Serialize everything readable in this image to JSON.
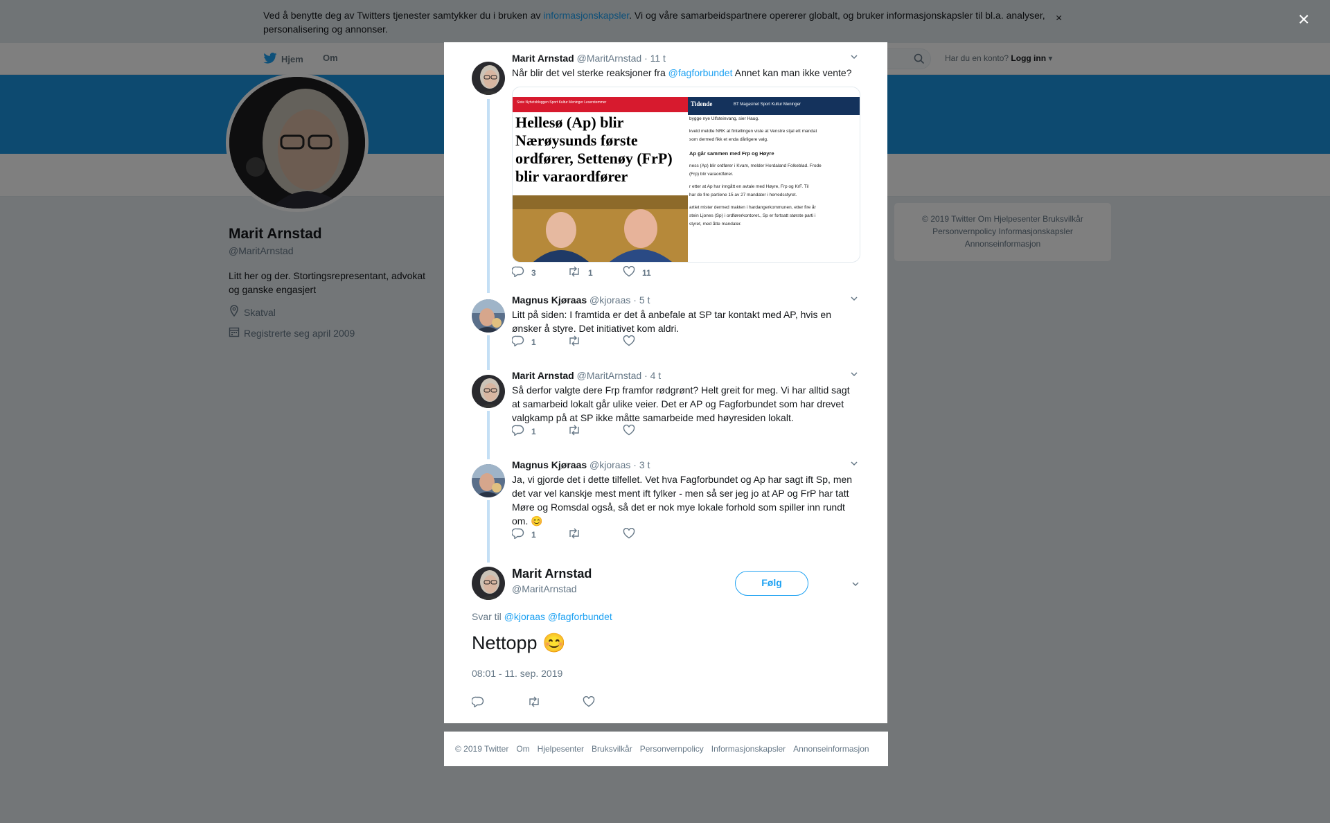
{
  "cookie_bar": {
    "text_before": "Ved å benytte deg av Twitters tjenester samtykker du i bruken av ",
    "link": "informasjonskapsler",
    "text_after": ". Vi og våre samarbeidspartnere opererer globalt, og bruker informasjonskapsler til bl.a. analyser, personalisering og annonser.",
    "close": "×"
  },
  "nav": {
    "home": "Hjem",
    "about": "Om",
    "account_q": "Har du en konto?",
    "login": "Logg inn"
  },
  "profile": {
    "name": "Marit Arnstad",
    "handle": "@MaritArnstad",
    "bio": "Litt her og der. Stortingsrepresentant, advokat og ganske engasjert",
    "location": "Skatval",
    "joined": "Registrerte seg april 2009"
  },
  "right_footer": {
    "line1": "© 2019 Twitter   Om   Hjelpesenter   Bruksvilkår",
    "line2": "Personvernpolicy   Informasjonskapsler",
    "line3": "Annonseinformasjon"
  },
  "overlay_close": "×",
  "tweets": [
    {
      "name": "Marit Arnstad",
      "handle": "@MaritArnstad",
      "time": "· 11 t",
      "text_before": "Når blir det vel sterke reaksjoner fra ",
      "mention": "@fagforbundet",
      "text_after": " Annet kan man ikke vente?",
      "replies": "3",
      "retweets": "1",
      "likes": "11",
      "media": {
        "left_headline": "Hellesø (Ap) blir Nærøysunds første ordfører, Settenøy (FrP) blir varaordfører",
        "left_nav": "Siste   Nyhetsbloggen   Sport   Kultur   Meninger   Leserstemmer",
        "right_masthead": "Tidende",
        "right_nav": "BT Magasinet   Sport   Kultur   Meninger",
        "right_lines": [
          "bygge nye Ulfsteinvang, sier Haug.",
          "kveld meldte NRK at fintellingen viste at Venstre stjal ett mandat",
          "som dermed fikk et enda dårligere valg.",
          "Ap går sammen med Frp og Høyre",
          "ness (Ap) blir ordfører i Kvam, melder Hordaland Folkeblad. Frode",
          "(Frp) blir varaordfører.",
          "r etter at Ap har inngått en avtale med Høyre, Frp og KrF. Til",
          "har de fire partiene 15 av 27 mandater i herredsstyret.",
          "artiet mister dermed makten i hardangerkommunen, etter fire år",
          "stein Ljones (Sp) i ordførerkontoret., Sp er fortsatt største parti i",
          "styret, med åtte mandater."
        ]
      }
    },
    {
      "name": "Magnus Kjøraas",
      "handle": "@kjoraas",
      "time": "· 5 t",
      "text": "Litt på siden: I framtida er det å anbefale at SP tar kontakt med AP, hvis en ønsker å styre. Det initiativet kom aldri.",
      "replies": "1",
      "retweets": "",
      "likes": ""
    },
    {
      "name": "Marit Arnstad",
      "handle": "@MaritArnstad",
      "time": "· 4 t",
      "text": "Så derfor valgte dere Frp framfor rødgrønt? Helt greit for meg. Vi har alltid sagt at samarbeid lokalt går ulike veier. Det er AP og Fagforbundet som har drevet valgkamp på at SP ikke måtte samarbeide med høyresiden lokalt.",
      "replies": "1",
      "retweets": "",
      "likes": ""
    },
    {
      "name": "Magnus Kjøraas",
      "handle": "@kjoraas",
      "time": "· 3 t",
      "text": "Ja, vi gjorde det i dette tilfellet. Vet hva Fagforbundet og Ap har sagt ift Sp, men det var vel kanskje mest ment ift fylker - men så ser jeg jo at AP og FrP har tatt Møre og Romsdal også, så det er nok mye lokale forhold som spiller inn rundt om.",
      "emoji": "😊",
      "replies": "1",
      "retweets": "",
      "likes": ""
    }
  ],
  "main_tweet": {
    "name": "Marit Arnstad",
    "handle": "@MaritArnstad",
    "follow": "Følg",
    "reply_to_label": "Svar til ",
    "reply_to": "@kjoraas @fagforbundet",
    "text": "Nettopp",
    "emoji": "😊",
    "timestamp": "08:01 - 11. sep. 2019"
  },
  "modal_footer": [
    "© 2019 Twitter",
    "Om",
    "Hjelpesenter",
    "Bruksvilkår",
    "Personvernpolicy",
    "Informasjonskapsler",
    "Annonseinformasjon"
  ],
  "colors": {
    "twitter_blue": "#1da1f2",
    "banner": "#1b95e0",
    "thread_line": "#c4dff5"
  }
}
